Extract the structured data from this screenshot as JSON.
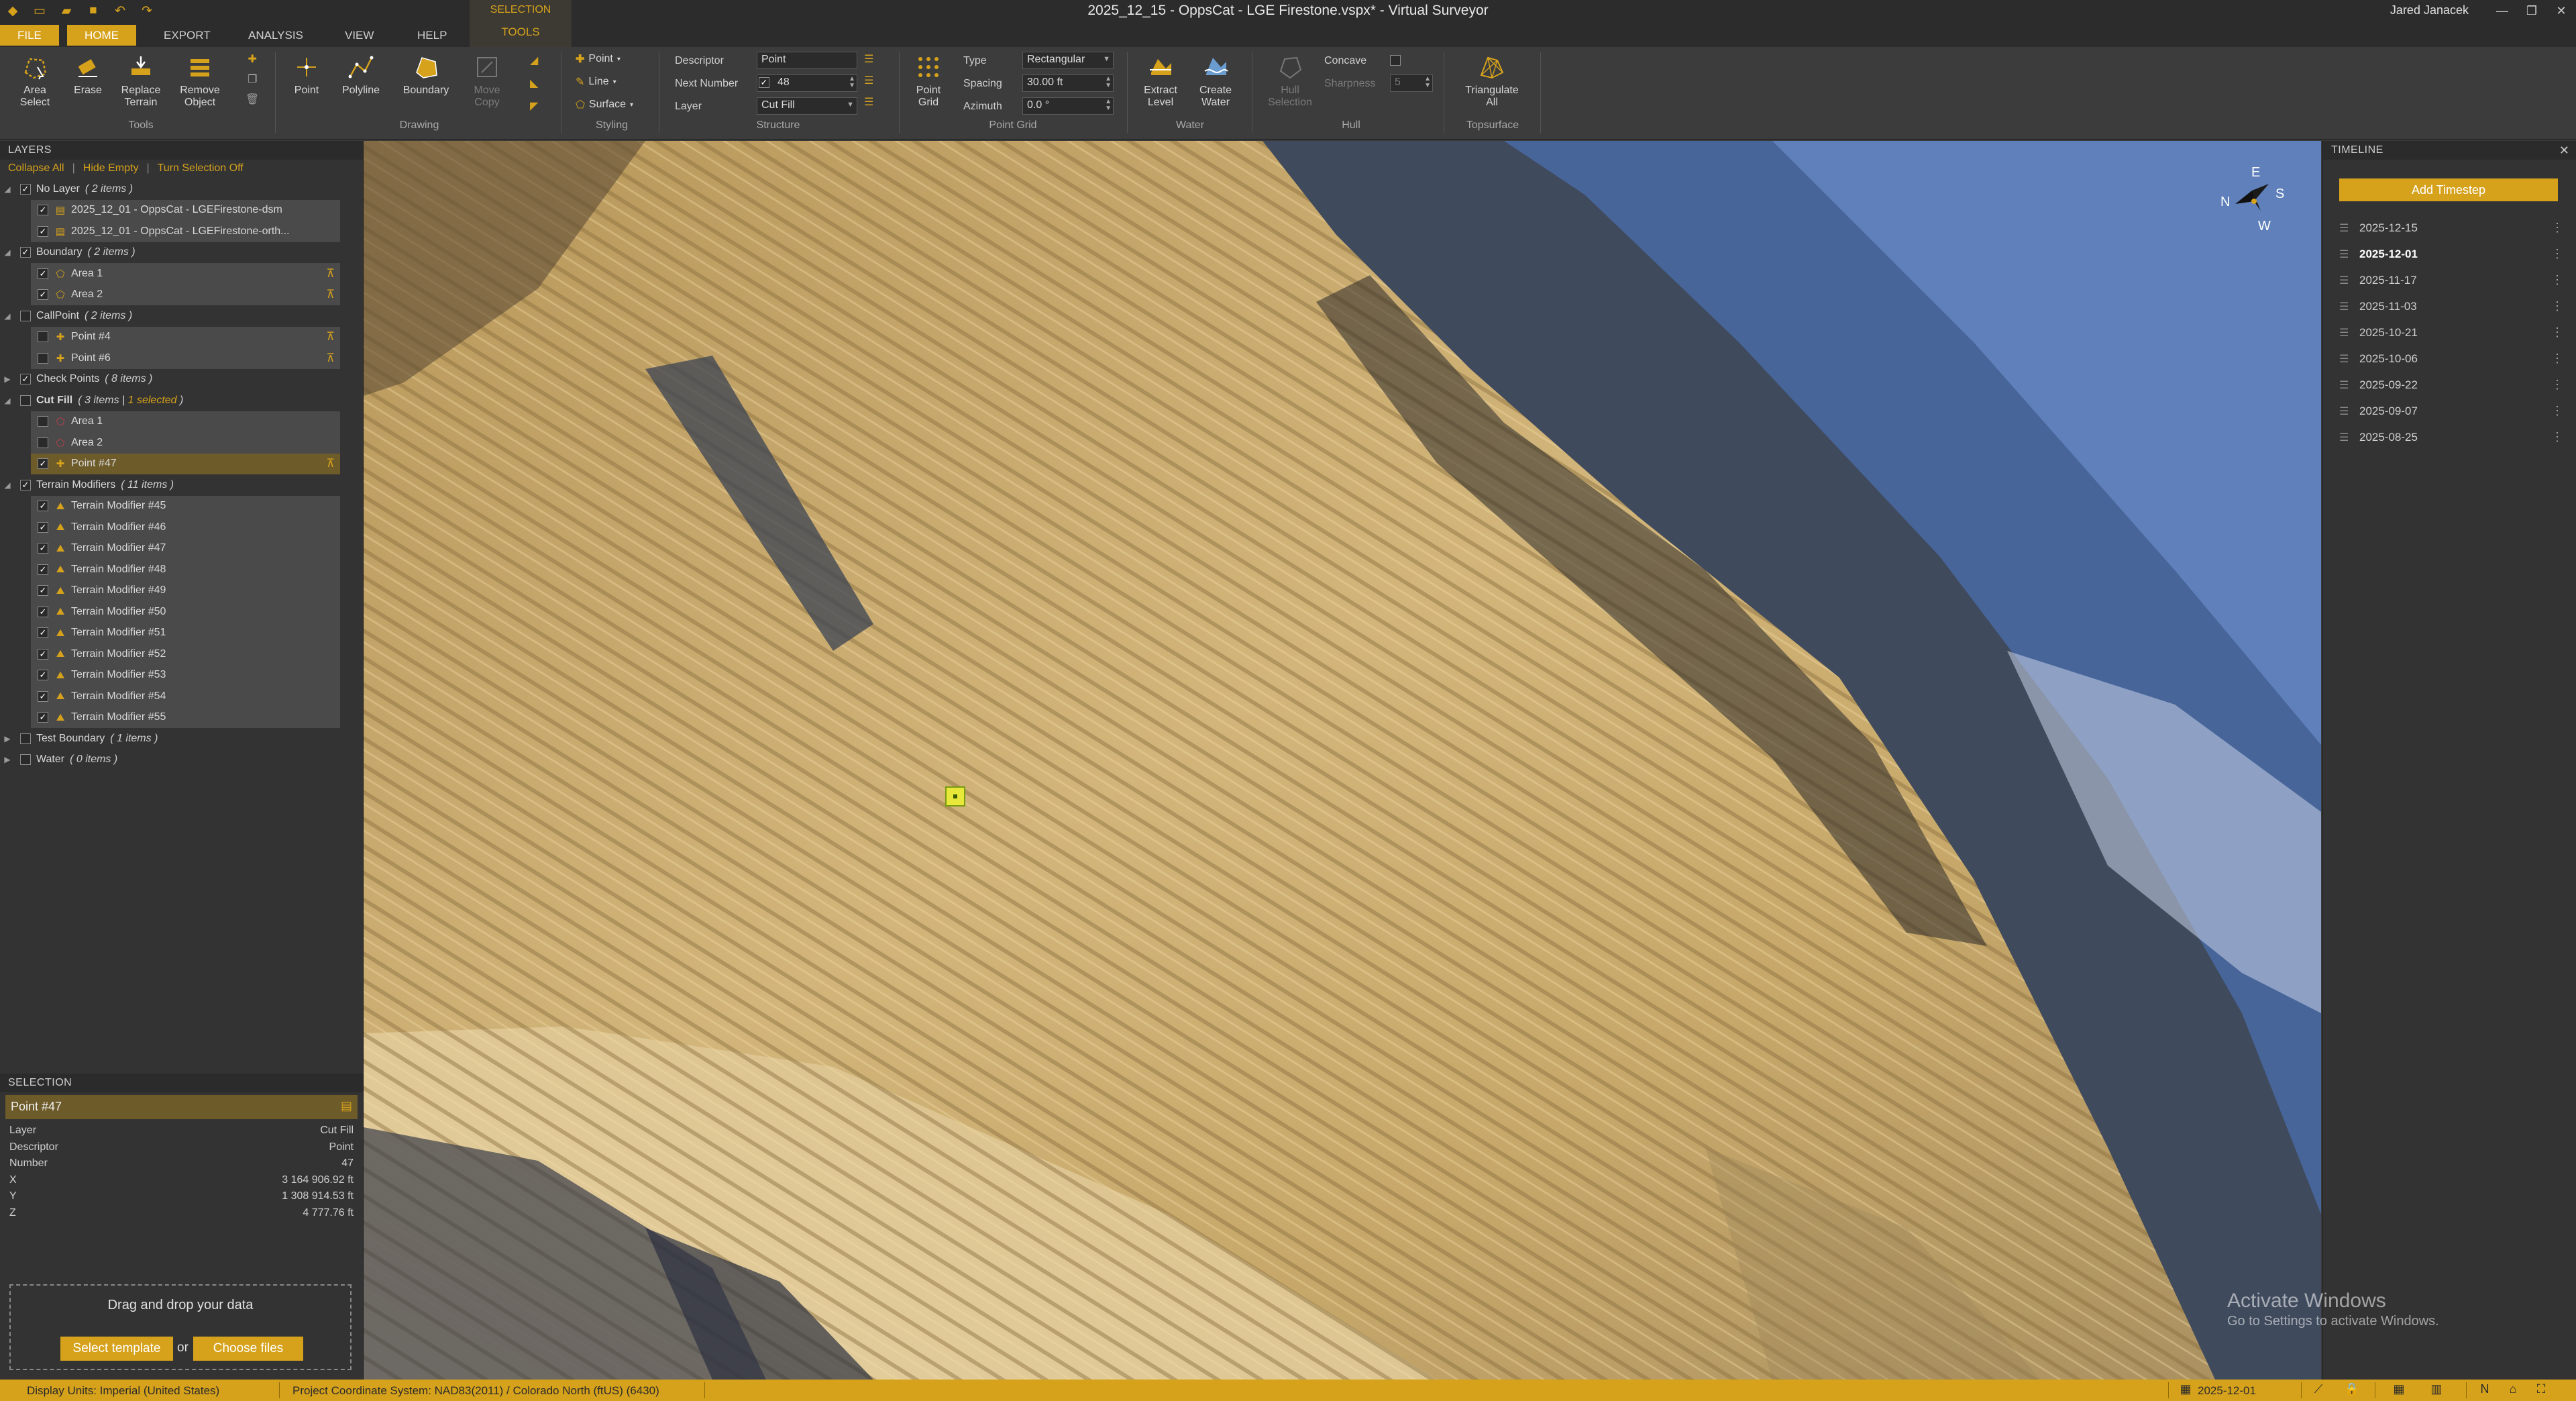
{
  "window": {
    "title": "2025_12_15 - OppsCat - LGE Firestone.vspx* - Virtual Surveyor",
    "user": "Jared Janacek"
  },
  "ribbon_tabs": [
    "FILE",
    "HOME",
    "EXPORT",
    "ANALYSIS",
    "VIEW",
    "HELP"
  ],
  "contextual": {
    "group": "SELECTION",
    "tab": "TOOLS"
  },
  "ribbon": {
    "tools": {
      "label": "Tools",
      "area_select": "Area\nSelect",
      "erase": "Erase",
      "replace_terrain": "Replace\nTerrain",
      "remove_object": "Remove\nObject"
    },
    "drawing": {
      "label": "Drawing",
      "point": "Point",
      "polyline": "Polyline",
      "boundary": "Boundary",
      "move_copy": "Move\nCopy"
    },
    "styling": {
      "label": "Styling",
      "point": "Point",
      "line": "Line",
      "surface": "Surface"
    },
    "structure": {
      "label": "Structure",
      "descriptor_label": "Descriptor",
      "descriptor_value": "Point",
      "next_number_label": "Next Number",
      "next_number_value": "48",
      "layer_label": "Layer",
      "layer_value": "Cut Fill"
    },
    "point_grid": {
      "label": "Point Grid",
      "button": "Point\nGrid",
      "type_label": "Type",
      "type_value": "Rectangular",
      "spacing_label": "Spacing",
      "spacing_value": "30.00 ft",
      "azimuth_label": "Azimuth",
      "azimuth_value": "0.0 °"
    },
    "water": {
      "label": "Water",
      "extract_level": "Extract\nLevel",
      "create_water": "Create\nWater"
    },
    "hull": {
      "label": "Hull",
      "hull_selection": "Hull\nSelection",
      "concave_label": "Concave",
      "sharpness_label": "Sharpness",
      "sharpness_value": "5"
    },
    "topsurface": {
      "label": "Topsurface",
      "triangulate_all": "Triangulate\nAll"
    }
  },
  "layers": {
    "header": "LAYERS",
    "actions": [
      "Collapse All",
      "Hide Empty",
      "Turn Selection Off"
    ],
    "groups": [
      {
        "name": "No Layer",
        "count": "( 2 items )",
        "checked": true,
        "expanded": true,
        "items": [
          {
            "name": "2025_12_01 - OppsCat - LGEFirestone-dsm",
            "checked": true,
            "icon": "surface"
          },
          {
            "name": "2025_12_01 - OppsCat - LGEFirestone-orth...",
            "checked": true,
            "icon": "surface"
          }
        ]
      },
      {
        "name": "Boundary",
        "count": "( 2 items )",
        "checked": true,
        "expanded": true,
        "items": [
          {
            "name": "Area 1",
            "checked": true,
            "icon": "area",
            "pin": true
          },
          {
            "name": "Area 2",
            "checked": true,
            "icon": "area",
            "pin": true
          }
        ]
      },
      {
        "name": "CallPoint",
        "count": "( 2 items )",
        "checked": false,
        "expanded": true,
        "items": [
          {
            "name": "Point #4",
            "checked": false,
            "icon": "point",
            "pin": true
          },
          {
            "name": "Point #6",
            "checked": false,
            "icon": "point",
            "pin": true
          }
        ]
      },
      {
        "name": "Check Points",
        "count": "( 8 items )",
        "checked": true,
        "expanded": false,
        "items": []
      },
      {
        "name": "Cut Fill",
        "count": "( 3 items |",
        "selected": "1 selected",
        "count_end": ")",
        "checked": false,
        "expanded": true,
        "bold": true,
        "items": [
          {
            "name": "Area 1",
            "checked": false,
            "icon": "area-red"
          },
          {
            "name": "Area 2",
            "checked": false,
            "icon": "area-red"
          },
          {
            "name": "Point #47",
            "checked": true,
            "icon": "point",
            "pin": true,
            "selected": true
          }
        ]
      },
      {
        "name": "Terrain Modifiers",
        "count": "( 11 items )",
        "checked": true,
        "expanded": true,
        "items": [
          {
            "name": "Terrain Modifier #45",
            "checked": true,
            "icon": "terrain"
          },
          {
            "name": "Terrain Modifier #46",
            "checked": true,
            "icon": "terrain"
          },
          {
            "name": "Terrain Modifier #47",
            "checked": true,
            "icon": "terrain"
          },
          {
            "name": "Terrain Modifier #48",
            "checked": true,
            "icon": "terrain"
          },
          {
            "name": "Terrain Modifier #49",
            "checked": true,
            "icon": "terrain"
          },
          {
            "name": "Terrain Modifier #50",
            "checked": true,
            "icon": "terrain"
          },
          {
            "name": "Terrain Modifier #51",
            "checked": true,
            "icon": "terrain"
          },
          {
            "name": "Terrain Modifier #52",
            "checked": true,
            "icon": "terrain"
          },
          {
            "name": "Terrain Modifier #53",
            "checked": true,
            "icon": "terrain"
          },
          {
            "name": "Terrain Modifier #54",
            "checked": true,
            "icon": "terrain"
          },
          {
            "name": "Terrain Modifier #55",
            "checked": true,
            "icon": "terrain"
          }
        ]
      },
      {
        "name": "Test Boundary",
        "count": "( 1 items )",
        "checked": false,
        "expanded": false,
        "items": []
      },
      {
        "name": "Water",
        "count": "( 0 items )",
        "checked": false,
        "expanded": false,
        "items": []
      }
    ]
  },
  "selection": {
    "header": "SELECTION",
    "title": "Point #47",
    "properties": [
      {
        "key": "Layer",
        "value": "Cut Fill"
      },
      {
        "key": "Descriptor",
        "value": "Point"
      },
      {
        "key": "Number",
        "value": "47"
      },
      {
        "key": "X",
        "value": "3 164 906.92 ft"
      },
      {
        "key": "Y",
        "value": "1 308 914.53 ft"
      },
      {
        "key": "Z",
        "value": "4 777.76 ft"
      }
    ]
  },
  "drop": {
    "text": "Drag and drop your data",
    "select_template": "Select template",
    "or": "or",
    "choose_files": "Choose files"
  },
  "compass": {
    "n": "N",
    "e": "E",
    "s": "S",
    "w": "W"
  },
  "timeline": {
    "header": "TIMELINE",
    "add_button": "Add Timestep",
    "current": "2025-12-01",
    "dates": [
      "2025-12-15",
      "2025-12-01",
      "2025-11-17",
      "2025-11-03",
      "2025-10-21",
      "2025-10-06",
      "2025-09-22",
      "2025-09-07",
      "2025-08-25"
    ]
  },
  "statusbar": {
    "display_units": "Display Units:  Imperial (United States)",
    "crs": "Project Coordinate System:  NAD83(2011) / Colorado North (ftUS) (6430)",
    "date": "2025-12-01"
  },
  "watermark": {
    "line1": "Activate Windows",
    "line2": "Go to Settings to activate Windows."
  },
  "colors": {
    "accent": "#d6a21c",
    "selected_row": "#6e5b2a",
    "marker": "#e8e83a"
  }
}
